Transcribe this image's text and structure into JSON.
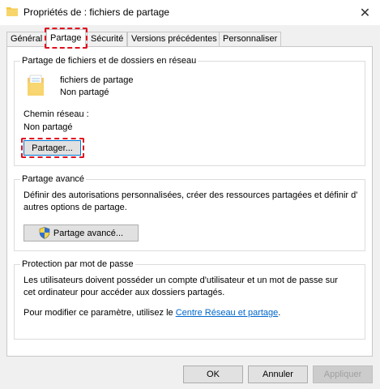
{
  "window": {
    "title": "Propriétés de : fichiers de partage",
    "close_icon": "✕"
  },
  "tabs": [
    {
      "label": "Général"
    },
    {
      "label": "Partage"
    },
    {
      "label": "Sécurité"
    },
    {
      "label": "Versions précédentes"
    },
    {
      "label": "Personnaliser"
    }
  ],
  "network_sharing": {
    "group_title": "Partage de fichiers et de dossiers en réseau",
    "folder_name": "fichiers de partage",
    "folder_status": "Non partagé",
    "path_label": "Chemin réseau :",
    "path_value": "Non partagé",
    "share_button": "Partager..."
  },
  "advanced_sharing": {
    "group_title": "Partage avancé",
    "description_line1": "Définir des autorisations personnalisées, créer des ressources partagées et définir d'",
    "description_line2": "autres options de partage.",
    "button": "Partage avancé..."
  },
  "password_protection": {
    "group_title": "Protection par mot de passe",
    "description_line1": "Les utilisateurs doivent posséder un compte d'utilisateur et un mot de passe sur",
    "description_line2": "cet ordinateur pour accéder aux dossiers partagés.",
    "change_text": "Pour modifier ce paramètre, utilisez le ",
    "link_text": "Centre Réseau et partage",
    "change_suffix": "."
  },
  "footer": {
    "ok": "OK",
    "cancel": "Annuler",
    "apply": "Appliquer"
  },
  "colors": {
    "highlight": "#e01020",
    "link": "#0066cc",
    "folder": "#f5c542"
  }
}
